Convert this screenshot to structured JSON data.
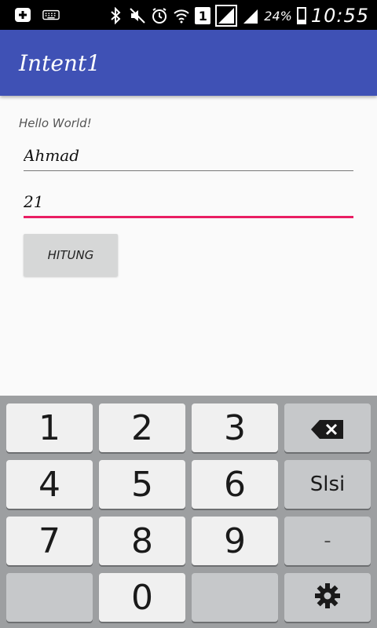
{
  "status_bar": {
    "icons": [
      "add-icon",
      "keyboard-icon",
      "bluetooth-icon",
      "mute-icon",
      "alarm-icon",
      "wifi-icon",
      "sim-icon",
      "signal-icon",
      "signal-bars-icon",
      "battery-icon"
    ],
    "sim_number": "1",
    "battery_percent": "24%",
    "battery_level": 0.24,
    "time": "10:55"
  },
  "app_bar": {
    "title": "Intent1",
    "color": "#3f51b5"
  },
  "content": {
    "hello_text": "Hello World!",
    "name_value": "Ahmad",
    "age_value": "21",
    "hitung_label": "HITUNG",
    "accent_color": "#e91e63"
  },
  "keyboard": {
    "rows": [
      [
        "1",
        "2",
        "3",
        "backspace"
      ],
      [
        "4",
        "5",
        "6",
        "Slsi"
      ],
      [
        "7",
        "8",
        "9",
        "-"
      ],
      [
        "",
        "0",
        "",
        "settings"
      ]
    ],
    "k1": "1",
    "k2": "2",
    "k3": "3",
    "k4": "4",
    "k5": "5",
    "k6": "6",
    "k7": "7",
    "k8": "8",
    "k9": "9",
    "k0": "0",
    "slsi": "Slsi",
    "dash": "-"
  }
}
